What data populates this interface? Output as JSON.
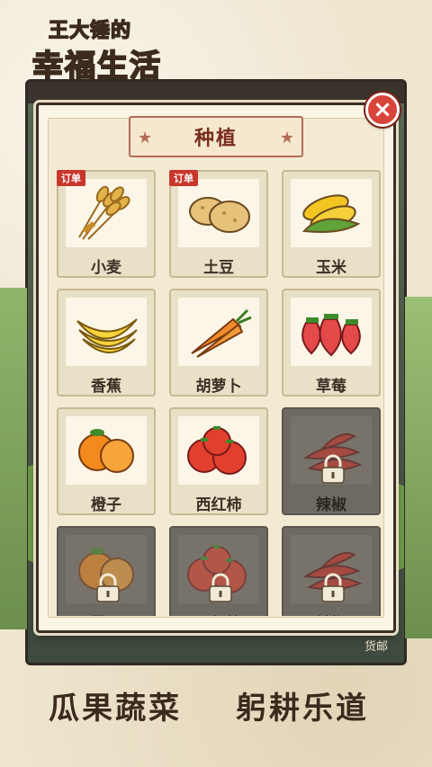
{
  "app": {
    "logo_line1": "王大锤的",
    "logo_line2": "幸福生活"
  },
  "scene": {
    "corner_label": "货邮"
  },
  "modal": {
    "title": "种植",
    "close_symbol": "×"
  },
  "crops": [
    {
      "name": "小麦",
      "icon": "wheat-icon",
      "badge": "订单",
      "locked": false
    },
    {
      "name": "土豆",
      "icon": "potato-icon",
      "badge": "订单",
      "locked": false
    },
    {
      "name": "玉米",
      "icon": "corn-icon",
      "badge": "",
      "locked": false
    },
    {
      "name": "香蕉",
      "icon": "banana-icon",
      "badge": "",
      "locked": false
    },
    {
      "name": "胡萝卜",
      "icon": "carrot-icon",
      "badge": "",
      "locked": false
    },
    {
      "name": "草莓",
      "icon": "strawberry-icon",
      "badge": "",
      "locked": false
    },
    {
      "name": "橙子",
      "icon": "orange-icon",
      "badge": "",
      "locked": false
    },
    {
      "name": "西红柿",
      "icon": "tomato-icon",
      "badge": "",
      "locked": false
    },
    {
      "name": "辣椒",
      "icon": "chili-icon",
      "badge": "",
      "locked": true
    },
    {
      "name": "橙子",
      "icon": "orange-icon",
      "badge": "",
      "locked": true
    },
    {
      "name": "西红柿",
      "icon": "tomato-icon",
      "badge": "",
      "locked": true
    },
    {
      "name": "辣椒",
      "icon": "chili-icon",
      "badge": "",
      "locked": true
    }
  ],
  "slogans": {
    "left": "瓜果蔬菜",
    "right": "躬耕乐道"
  },
  "colors": {
    "badge_red": "#c8372c",
    "close_red": "#d9443a",
    "title_brown": "#7a2d1e"
  }
}
